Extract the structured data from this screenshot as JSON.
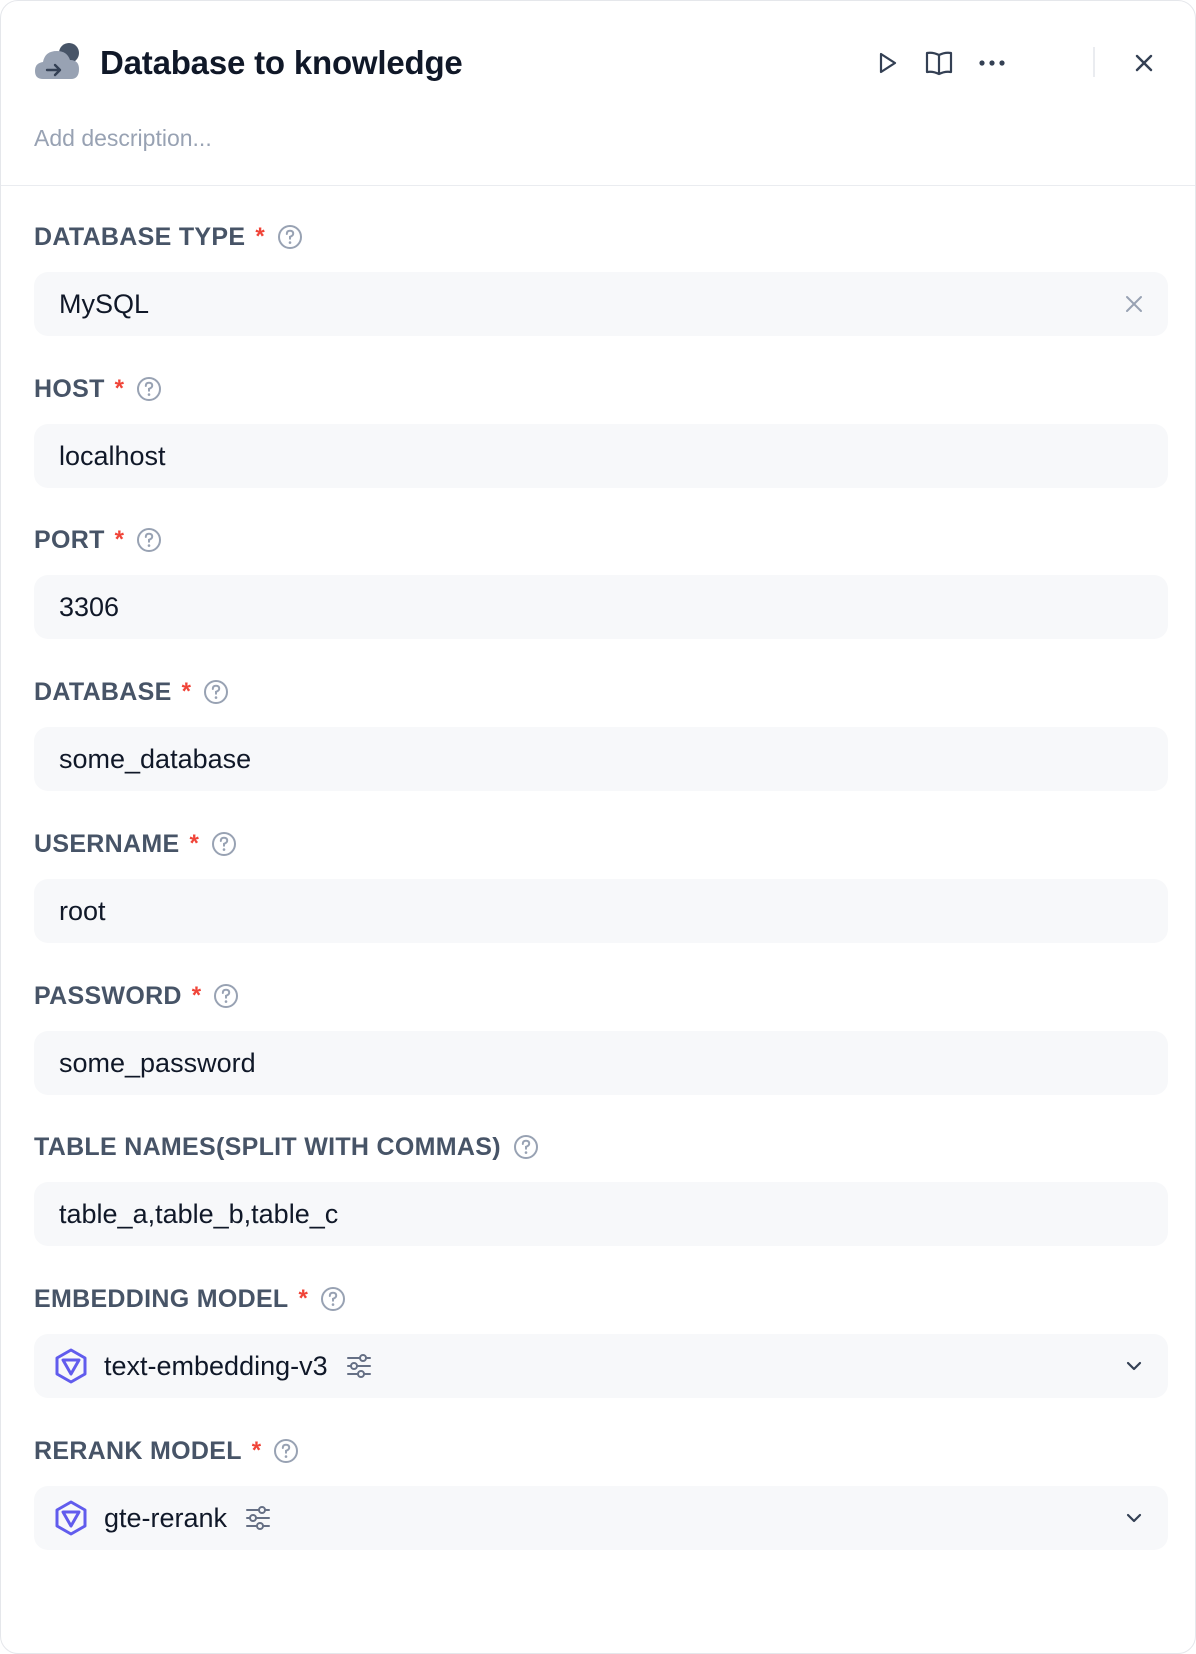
{
  "header": {
    "title": "Database to knowledge",
    "description_placeholder": "Add description..."
  },
  "icons": {
    "node": "cloud-import-icon",
    "run": "play-icon",
    "docs": "book-icon",
    "more": "more-horizontal-icon",
    "close": "close-icon",
    "help": "question-circle-icon",
    "clear": "clear-x-icon",
    "model": "model-provider-icon",
    "settings": "sliders-icon",
    "dropdown": "chevron-down-icon"
  },
  "colors": {
    "required": "#f04438",
    "label": "#475467",
    "field_bg": "#f7f8fa",
    "model_icon": "#615ced"
  },
  "fields": {
    "db_type": {
      "label": "DATABASE TYPE",
      "required_mark": "*",
      "value": "MySQL"
    },
    "host": {
      "label": "HOST",
      "required_mark": "*",
      "value": "localhost"
    },
    "port": {
      "label": "PORT",
      "required_mark": "*",
      "value": "3306"
    },
    "database": {
      "label": "DATABASE",
      "required_mark": "*",
      "value": "some_database"
    },
    "username": {
      "label": "USERNAME",
      "required_mark": "*",
      "value": "root"
    },
    "password": {
      "label": "PASSWORD",
      "required_mark": "*",
      "value": "some_password"
    },
    "table_names": {
      "label": "TABLE NAMES(SPLIT WITH COMMAS)",
      "value": "table_a,table_b,table_c"
    },
    "embedding_model": {
      "label": "EMBEDDING MODEL",
      "required_mark": "*",
      "value": "text-embedding-v3"
    },
    "rerank_model": {
      "label": "RERANK MODEL",
      "required_mark": "*",
      "value": "gte-rerank"
    }
  }
}
